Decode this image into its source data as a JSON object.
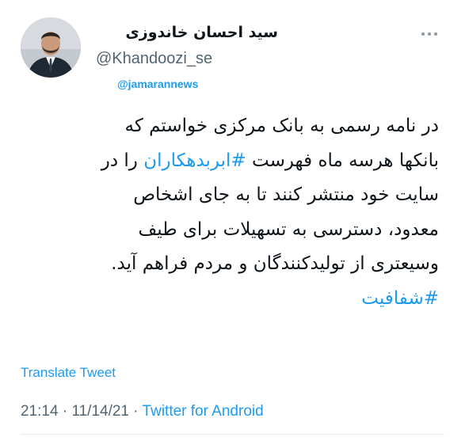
{
  "author": {
    "display_name": "سید احسان خاندوزی",
    "handle": "@Khandoozi_se"
  },
  "watermark": "@jamarannews",
  "tweet": {
    "line1": "در نامه رسمی به بانک مرکزی خواستم که",
    "line2_pre": "بانکها هرسه ماه فهرست ",
    "line2_hashtag": "#ابربدهکاران",
    "line2_post": " را در",
    "line3": "سایت خود منتشر کنند تا به جای اشخاص",
    "line4": "معدود، دسترسی به تسهیلات برای طیف",
    "line5": "وسیعتری از تولیدکنندگان و مردم فراهم آید.",
    "line6_hashtag": "#شفافیت"
  },
  "translate_label": "Translate Tweet",
  "meta": {
    "time": "21:14",
    "date": "11/14/21",
    "separator": " · ",
    "client": "Twitter for Android"
  },
  "icons": {
    "more": "more-horizontal-icon",
    "avatar": "profile-photo"
  },
  "colors": {
    "link": "#1d9bf0",
    "text": "#0f1419",
    "secondary": "#536471"
  }
}
